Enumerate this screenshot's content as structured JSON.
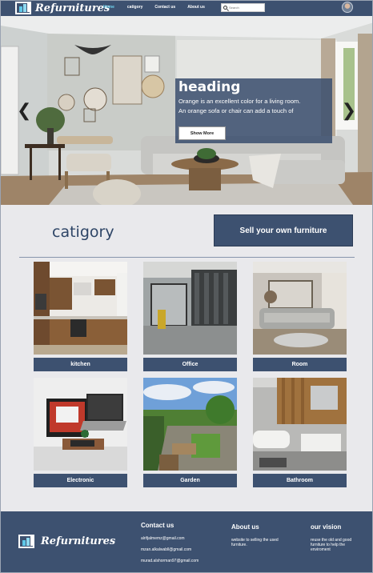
{
  "brand": {
    "name": "Refurnitures"
  },
  "nav": {
    "links": [
      "Home",
      "catigory",
      "Contact us",
      "About us"
    ],
    "active": "Home",
    "search_placeholder": "Search"
  },
  "hero": {
    "heading": "heading",
    "text_line1": "Orange is an excellent color for a living room.",
    "text_line2": "An orange sofa or chair can add a touch of",
    "button": "Show More",
    "prev": "❮",
    "next": "❯"
  },
  "category": {
    "title": "catigory",
    "sell_button": "Sell your own furniture",
    "items": [
      {
        "label": "kitchen"
      },
      {
        "label": "Office"
      },
      {
        "label": "Room"
      },
      {
        "label": "Electronic"
      },
      {
        "label": "Garden"
      },
      {
        "label": "Bathroom"
      }
    ]
  },
  "footer": {
    "contact": {
      "title": "Contact us",
      "emails": [
        "alrifjalmemz@gmail.com",
        "mzan.alkalwabll@gmail.com",
        "murad.alshorman97@gmail.com"
      ]
    },
    "about": {
      "title": "About us",
      "text_line1": "website to selling the used",
      "text_line2": "furniture."
    },
    "vision": {
      "title": "our vision",
      "text_line1": "reuse the old and good",
      "text_line2": "furniture to help the",
      "text_line3": "enviroment"
    }
  },
  "colors": {
    "primary": "#3d5170",
    "accent": "#6ed3ee",
    "background": "#e9e9ec"
  }
}
